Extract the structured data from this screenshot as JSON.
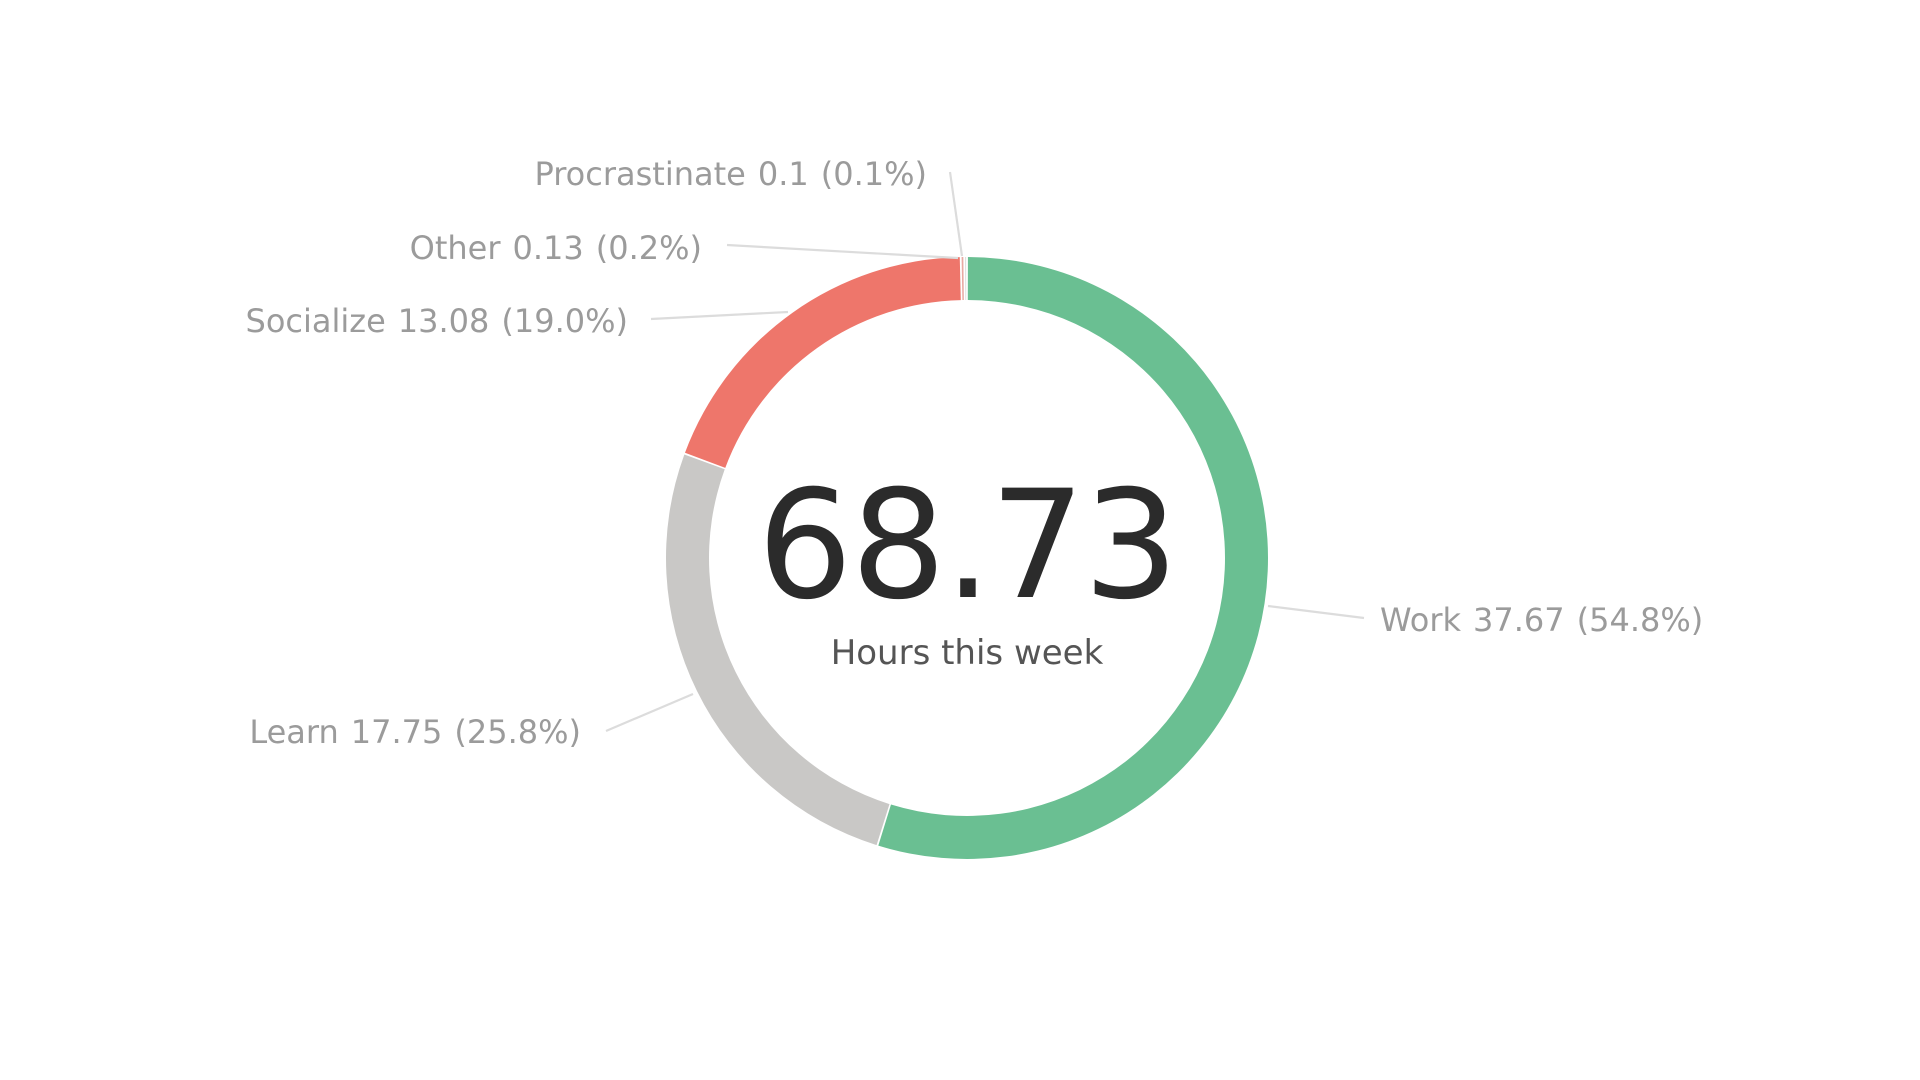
{
  "chart_data": {
    "type": "pie",
    "variant": "donut",
    "title": "",
    "center": {
      "value": "68.73",
      "caption": "Hours this week"
    },
    "series": [
      {
        "name": "Hours",
        "slices": [
          {
            "label": "Work",
            "value": 37.67,
            "value_text": "37.67",
            "percent_text": "(54.8%)",
            "color": "#6abf92"
          },
          {
            "label": "Learn",
            "value": 17.75,
            "value_text": "17.75",
            "percent_text": "(25.8%)",
            "color": "#c9c8c6"
          },
          {
            "label": "Socialize",
            "value": 13.08,
            "value_text": "13.08",
            "percent_text": "(19.0%)",
            "color": "#ee766b"
          },
          {
            "label": "Other",
            "value": 0.13,
            "value_text": "0.13",
            "percent_text": "(0.2%)",
            "color": "#e8a9a2"
          },
          {
            "label": "Procrastinate",
            "value": 0.1,
            "value_text": "0.1",
            "percent_text": "(0.1%)",
            "color": "#d9d9d9"
          }
        ]
      }
    ],
    "legend": "none",
    "labels": "outside-with-leader-lines"
  }
}
